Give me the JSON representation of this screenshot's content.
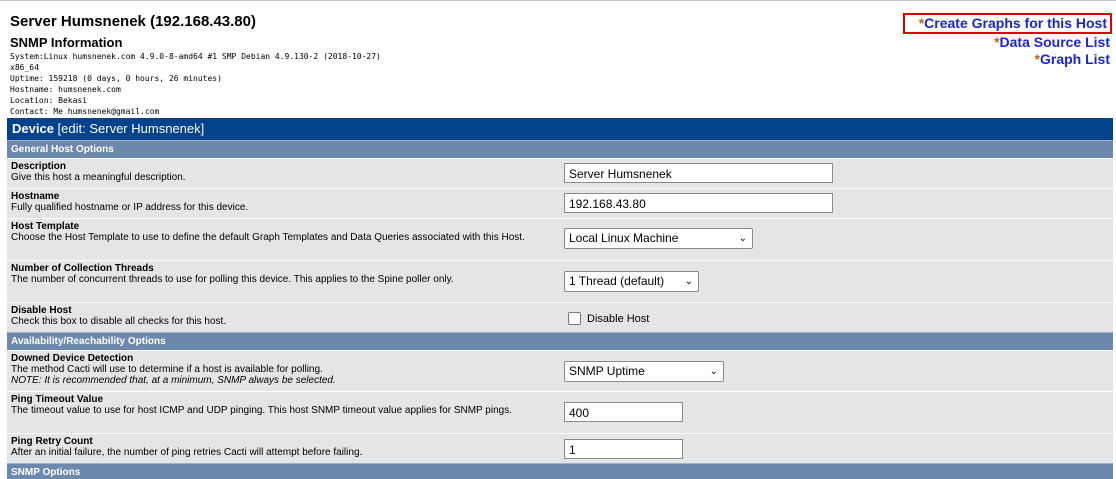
{
  "header": {
    "server_title": "Server Humsnenek (192.168.43.80)",
    "snmp_title": "SNMP Information",
    "snmp_lines": [
      "System:Linux humsnenek.com 4.9.0-8-amd64 #1 SMP Debian 4.9.130-2 (2018-10-27)",
      "x86_64",
      "Uptime: 159218 (0 days, 0 hours, 26 minutes)",
      "Hostname: humsnenek.com",
      "Location: Bekasi",
      "Contact: Me humsnenek@gmail.com"
    ],
    "links": {
      "star": "*",
      "create_graphs": "Create Graphs for this Host",
      "data_source_list": "Data Source List",
      "graph_list": "Graph List"
    }
  },
  "device": {
    "label": "Device",
    "edit": "[edit: Server Humsnenek]"
  },
  "sections": {
    "general": "General Host Options",
    "availability": "Availability/Reachability Options",
    "snmp": "SNMP Options"
  },
  "fields": {
    "description": {
      "title": "Description",
      "desc": "Give this host a meaningful description.",
      "value": "Server Humsnenek"
    },
    "hostname": {
      "title": "Hostname",
      "desc": "Fully qualified hostname or IP address for this device.",
      "value": "192.168.43.80"
    },
    "host_template": {
      "title": "Host Template",
      "desc": "Choose the Host Template to use to define the default Graph Templates and Data Queries associated with this Host.",
      "value": "Local Linux Machine"
    },
    "threads": {
      "title": "Number of Collection Threads",
      "desc": "The number of concurrent threads to use for polling this device. This applies to the Spine poller only.",
      "value": "1 Thread (default)"
    },
    "disable_host": {
      "title": "Disable Host",
      "desc": "Check this box to disable all checks for this host.",
      "checkbox_label": "Disable Host",
      "checked": false
    },
    "downed_detection": {
      "title": "Downed Device Detection",
      "desc": "The method Cacti will use to determine if a host is available for polling.",
      "note": "NOTE: It is recommended that, at a minimum, SNMP always be selected.",
      "value": "SNMP Uptime"
    },
    "ping_timeout": {
      "title": "Ping Timeout Value",
      "desc": "The timeout value to use for host ICMP and UDP pinging. This host SNMP timeout value applies for SNMP pings.",
      "value": "400"
    },
    "ping_retry": {
      "title": "Ping Retry Count",
      "desc": "After an initial failure, the number of ping retries Cacti will attempt before failing.",
      "value": "1"
    }
  },
  "icons": {
    "dropdown": "chevron-down-icon",
    "checkbox": "checkbox-unchecked"
  }
}
